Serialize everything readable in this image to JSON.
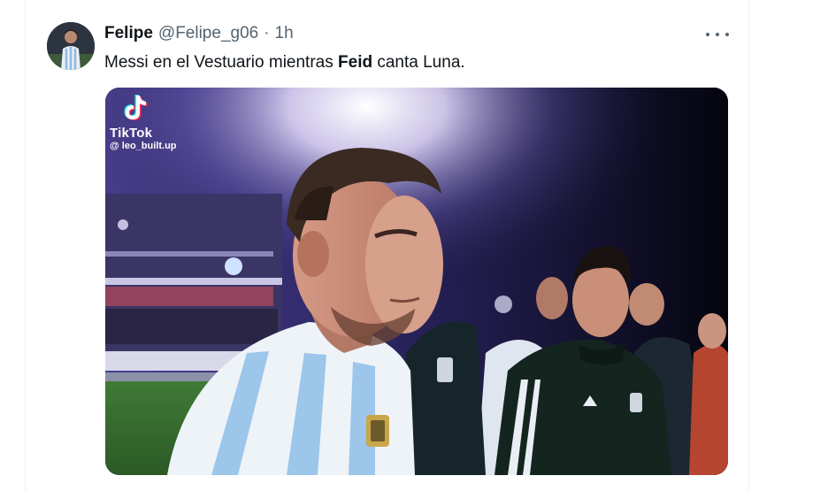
{
  "tweet": {
    "display_name": "Felipe",
    "handle": "@Felipe_g06",
    "separator": "·",
    "time": "1h",
    "text_before": "Messi en el Vestuario mientras ",
    "text_bold": "Feid",
    "text_after": " canta Luna."
  },
  "media": {
    "watermark_brand": "TikTok",
    "watermark_user": "@ leo_built.up"
  },
  "icons": {
    "more": "more-horizontal-icon",
    "tiktok": "tiktok-logo-icon"
  },
  "colors": {
    "text_primary": "#0f1419",
    "text_secondary": "#536471",
    "divider": "#eff3f4"
  }
}
